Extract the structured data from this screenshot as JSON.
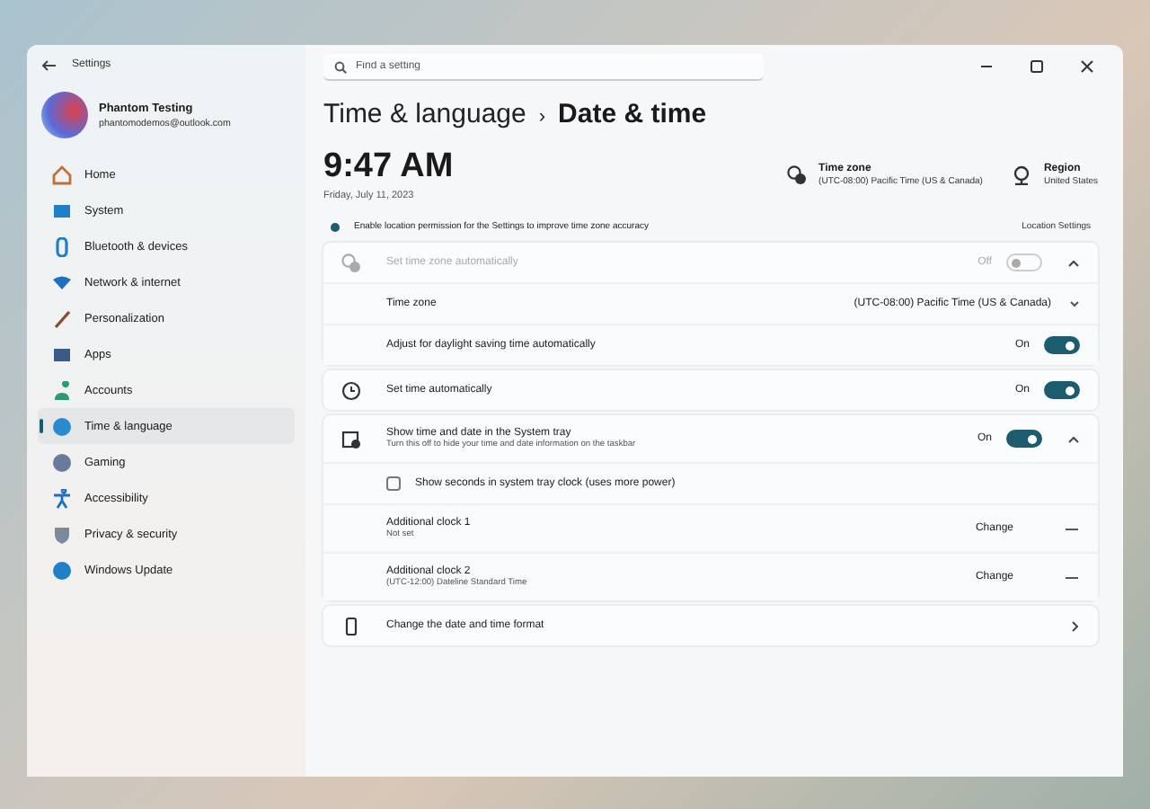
{
  "window": {
    "title": "Settings",
    "search_placeholder": "Find a setting"
  },
  "user": {
    "name": "Phantom Testing",
    "email": "phantomodemos@outlook.com"
  },
  "sidebar": {
    "items": [
      {
        "label": "Home",
        "kind": "home",
        "selected": false
      },
      {
        "label": "System",
        "kind": "system",
        "selected": false
      },
      {
        "label": "Bluetooth & devices",
        "kind": "bluetooth",
        "selected": false
      },
      {
        "label": "Network & internet",
        "kind": "wifi",
        "selected": false
      },
      {
        "label": "Personalization",
        "kind": "pen",
        "selected": false
      },
      {
        "label": "Apps",
        "kind": "apps",
        "selected": false
      },
      {
        "label": "Accounts",
        "kind": "person",
        "selected": false
      },
      {
        "label": "Time & language",
        "kind": "globe",
        "selected": true
      },
      {
        "label": "Gaming",
        "kind": "gamepad",
        "selected": false
      },
      {
        "label": "Accessibility",
        "kind": "access",
        "selected": false
      },
      {
        "label": "Privacy & security",
        "kind": "shield",
        "selected": false
      },
      {
        "label": "Windows Update",
        "kind": "update",
        "selected": false
      }
    ]
  },
  "breadcrumb": {
    "parent": "Time & language",
    "separator": "›",
    "current": "Date & time"
  },
  "clock": {
    "time": "9:47 AM",
    "date": "Friday, July 11, 2023"
  },
  "info": [
    {
      "title": "Time zone",
      "value": "(UTC-08:00) Pacific Time (US & Canada)"
    },
    {
      "title": "Region",
      "value": "United States"
    }
  ],
  "banner": {
    "text": "Enable location permission for the Settings to improve time zone accuracy",
    "link": "Location Settings"
  },
  "cards": [
    {
      "rows": [
        {
          "kind": "toggle",
          "label": "Set time zone automatically",
          "disabled": true,
          "state_label": "Off",
          "on": false,
          "expanded": true
        },
        {
          "kind": "dropdown",
          "label": "Time zone",
          "value": "(UTC-08:00) Pacific Time (US & Canada)"
        },
        {
          "kind": "toggle",
          "label": "Adjust for daylight saving time automatically",
          "disabled": false,
          "state_label": "On",
          "on": true
        }
      ]
    },
    {
      "rows": [
        {
          "kind": "toggle",
          "label": "Set time automatically",
          "disabled": false,
          "state_label": "On",
          "on": true
        }
      ]
    },
    {
      "rows": [
        {
          "kind": "toggle",
          "label": "Show time and date in the System tray",
          "subtitle": "Turn this off to hide your time and date information on the taskbar",
          "disabled": false,
          "state_label": "On",
          "on": true,
          "expanded": true
        },
        {
          "kind": "checkbox",
          "label": "Show seconds in system tray clock (uses more power)",
          "checked": false
        },
        {
          "kind": "clock",
          "label": "Additional clock 1",
          "subtitle": "Not set",
          "action": "Change"
        },
        {
          "kind": "clock",
          "label": "Additional clock 2",
          "subtitle": "(UTC-12:00) Dateline Standard Time",
          "action": "Change"
        }
      ]
    },
    {
      "rows": [
        {
          "kind": "link",
          "label": "Change the date and time format"
        }
      ]
    }
  ]
}
